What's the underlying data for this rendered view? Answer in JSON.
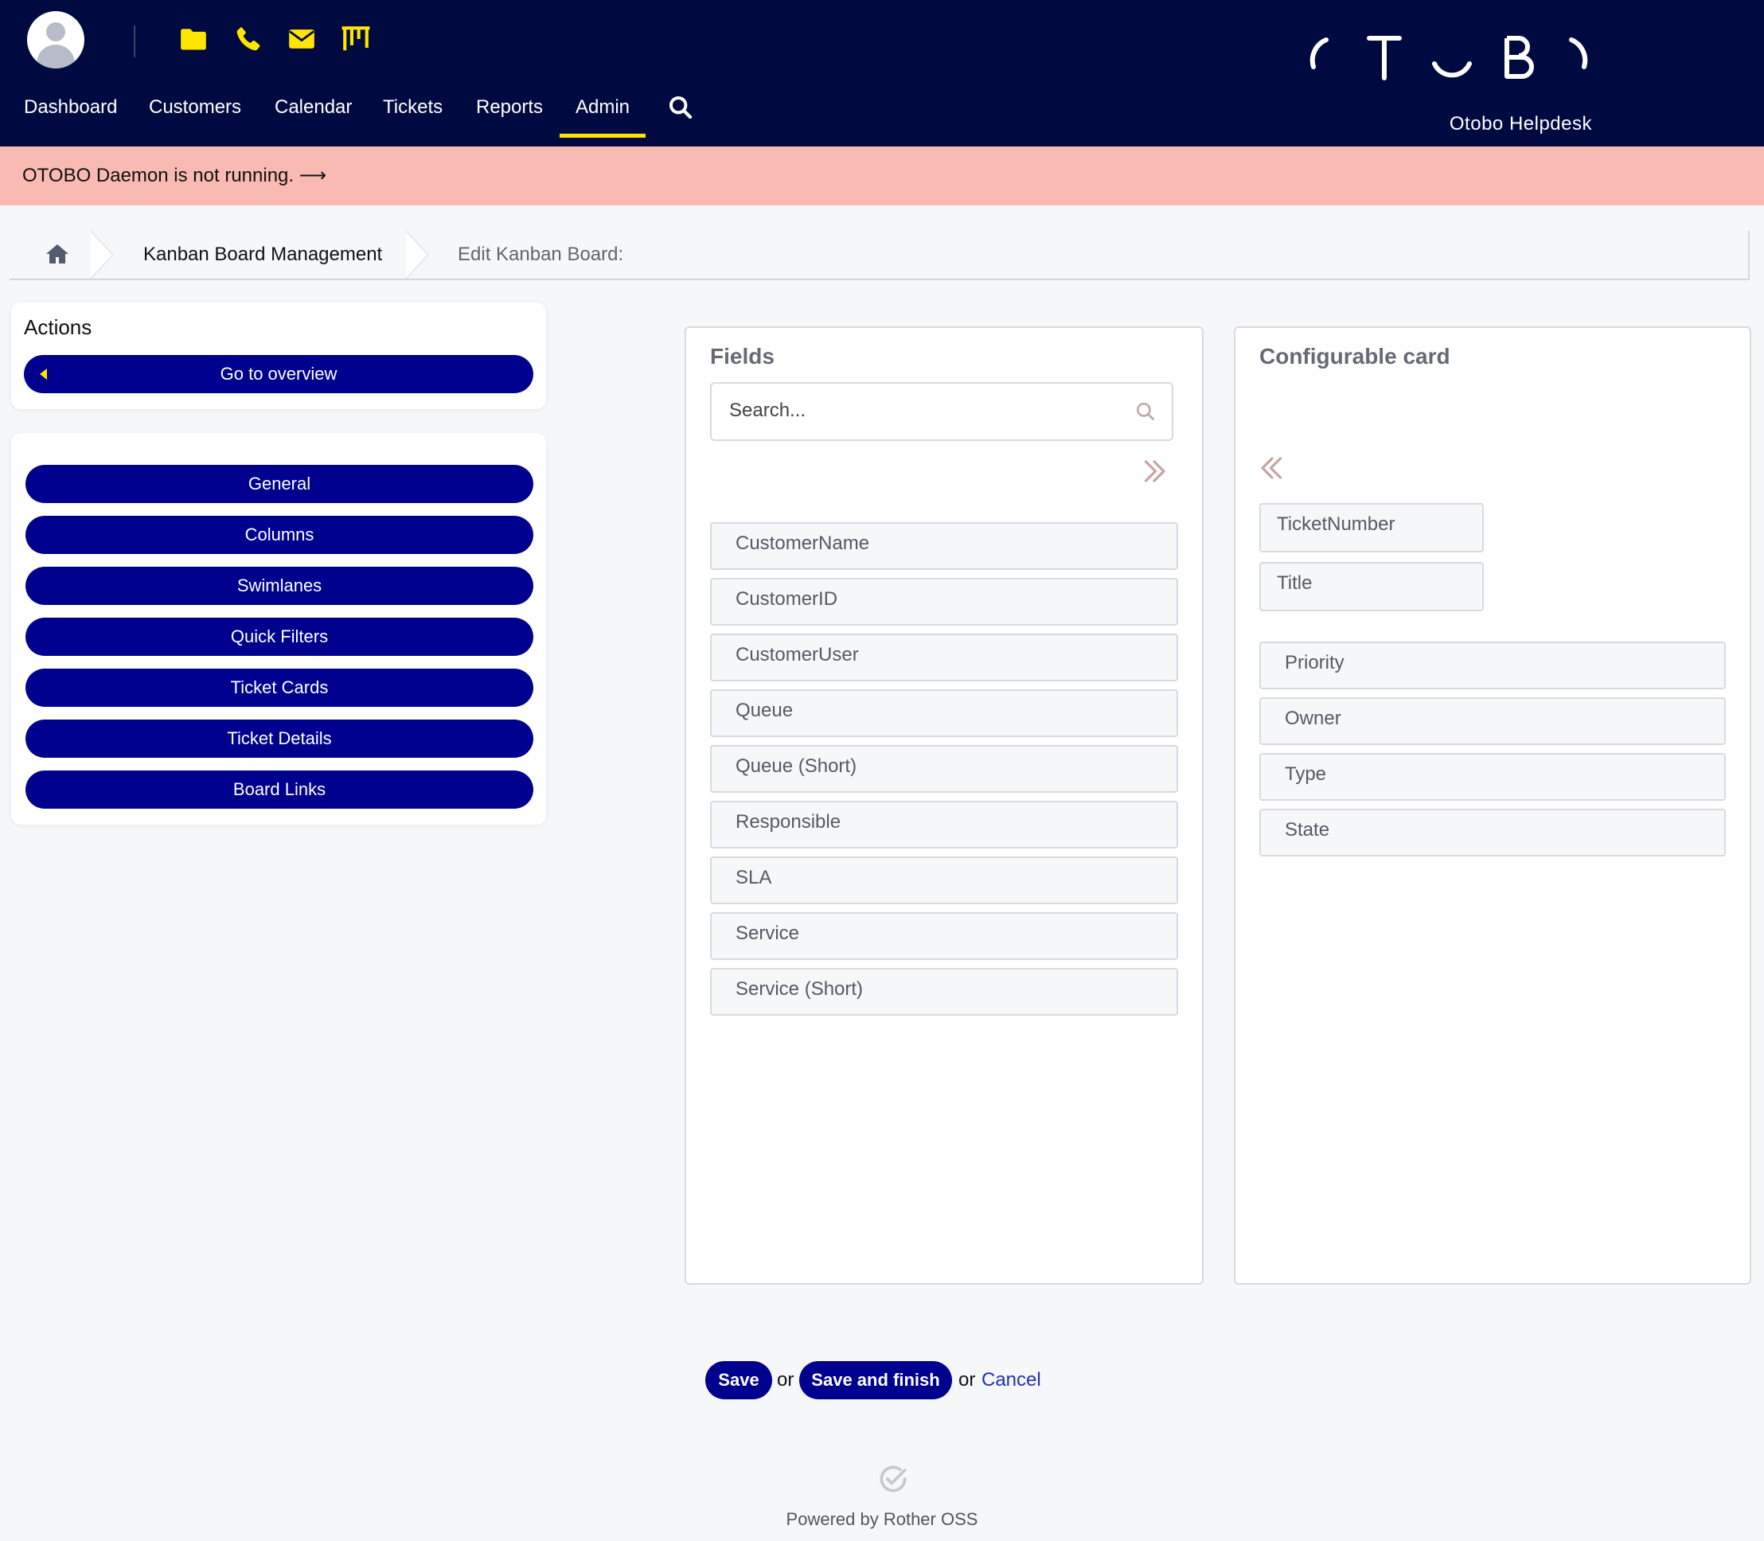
{
  "header": {
    "quick_icons": [
      "folder-icon",
      "phone-icon",
      "envelope-icon",
      "kanban-icon"
    ],
    "nav": [
      {
        "label": "Dashboard",
        "active": false
      },
      {
        "label": "Customers",
        "active": false
      },
      {
        "label": "Calendar",
        "active": false
      },
      {
        "label": "Tickets",
        "active": false
      },
      {
        "label": "Reports",
        "active": false
      },
      {
        "label": "Admin",
        "active": true
      }
    ],
    "logo_subtitle": "Otobo Helpdesk"
  },
  "banner": {
    "text": "OTOBO Daemon is not running. ⟶"
  },
  "breadcrumb": {
    "items": [
      "Kanban Board Management",
      "Edit Kanban Board:"
    ]
  },
  "actions": {
    "title": "Actions",
    "go_to_overview": "Go to overview"
  },
  "sections": [
    "General",
    "Columns",
    "Swimlanes",
    "Quick Filters",
    "Ticket Cards",
    "Ticket Details",
    "Board Links"
  ],
  "fields_panel": {
    "title": "Fields",
    "search_placeholder": "Search...",
    "items": [
      "CustomerName",
      "CustomerID",
      "CustomerUser",
      "Queue",
      "Queue (Short)",
      "Responsible",
      "SLA",
      "Service",
      "Service (Short)"
    ]
  },
  "card_panel": {
    "title": "Configurable card",
    "header_items": [
      "TicketNumber",
      "Title"
    ],
    "body_items": [
      "Priority",
      "Owner",
      "Type",
      "State"
    ]
  },
  "footer": {
    "save": "Save",
    "or1": "or",
    "save_finish": "Save and finish",
    "or2": "or",
    "cancel": "Cancel",
    "powered": "Powered by Rother OSS"
  },
  "colors": {
    "header_bg": "#000a40",
    "accent_yellow": "#ffe600",
    "button_blue": "#00008f",
    "banner_bg": "#f8bab2",
    "link_blue": "#1f30c0"
  }
}
